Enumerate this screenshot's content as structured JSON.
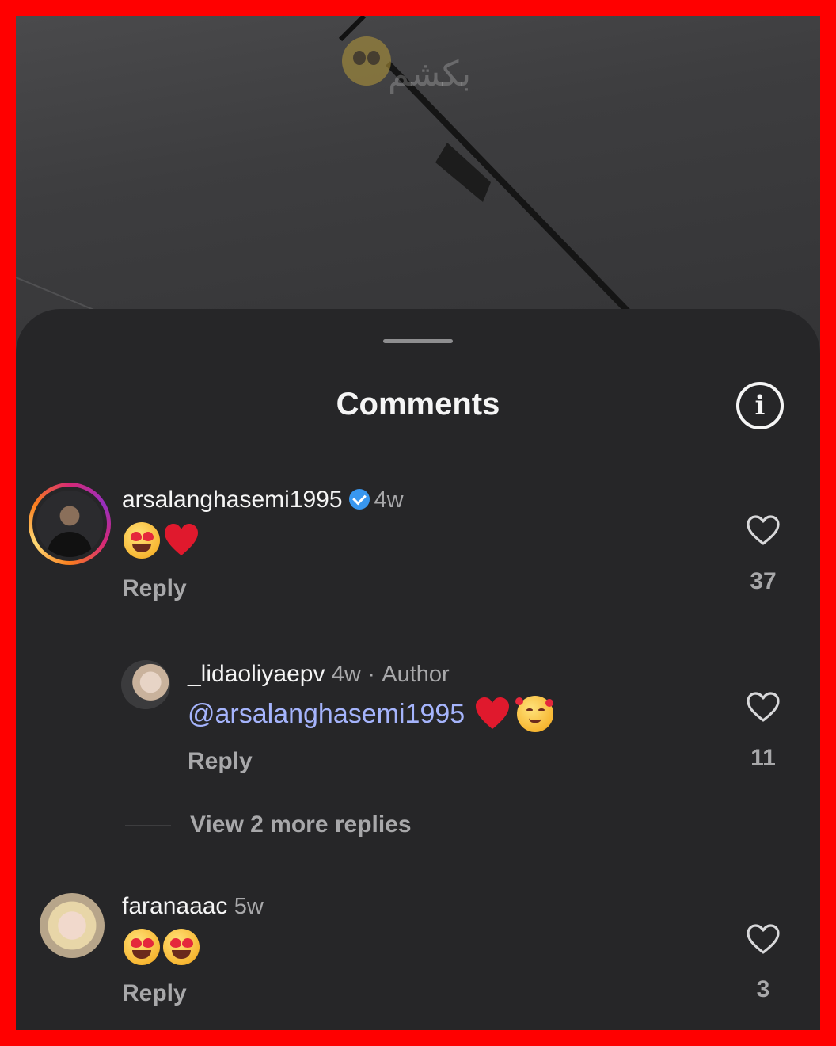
{
  "sheet": {
    "title": "Comments",
    "info_icon": "info-icon"
  },
  "comments": [
    {
      "username": "arsalanghasemi1995",
      "verified": true,
      "time": "4w",
      "emojis": [
        "heart-eyes-emoji",
        "red-heart-emoji"
      ],
      "reply_label": "Reply",
      "likes": "37"
    },
    {
      "username": "_lidaoliyaepv",
      "time": "4w",
      "separator": "·",
      "badge": "Author",
      "mention": "@arsalanghasemi1995",
      "emojis": [
        "red-heart-emoji",
        "smiling-face-with-hearts-emoji"
      ],
      "reply_label": "Reply",
      "likes": "11"
    },
    {
      "username": "faranaaac",
      "time": "5w",
      "emojis": [
        "heart-eyes-emoji",
        "heart-eyes-emoji"
      ],
      "reply_label": "Reply",
      "likes": "3"
    }
  ],
  "view_more_replies": "View 2 more replies",
  "video_overlay": {
    "caption": "بکشم"
  }
}
